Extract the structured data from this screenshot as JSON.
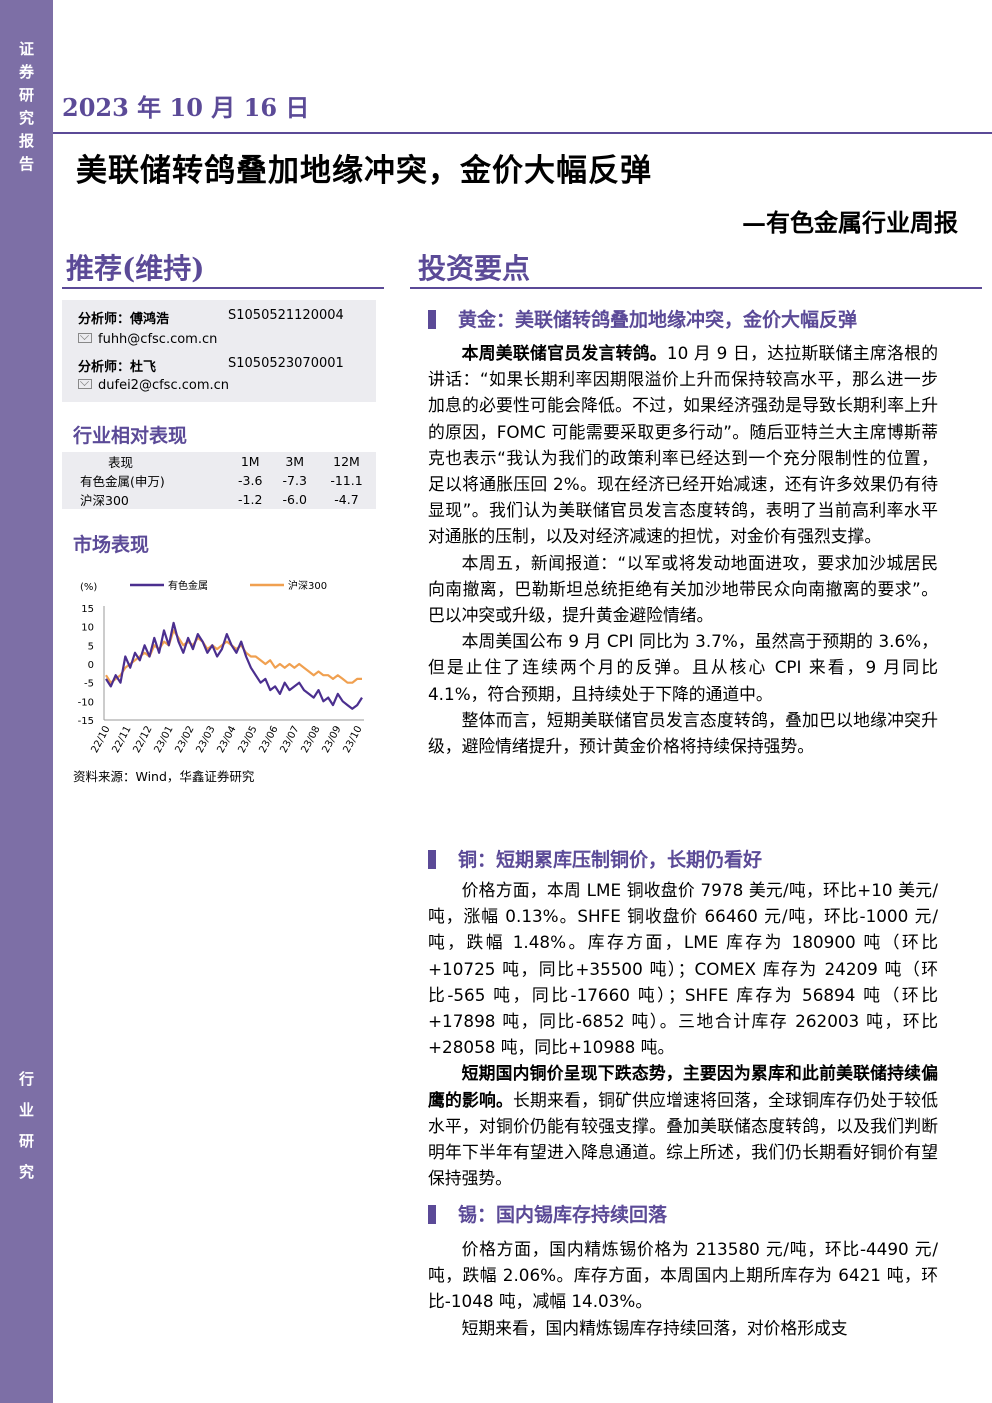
{
  "sidebar": {
    "top_chars": [
      "证",
      "券",
      "研",
      "究",
      "报",
      "告"
    ],
    "bottom_chars": [
      "行",
      "业",
      "研",
      "究"
    ]
  },
  "header": {
    "date": "2023 年 10 月 16 日",
    "title": "美联储转鸽叠加地缘冲突，金价大幅反弹",
    "subtitle": "—有色金属行业周报"
  },
  "left": {
    "rating": "推荐(维持)",
    "analysts": [
      {
        "label": "分析师：",
        "name": "傅鸿浩",
        "code": "S1050521120004",
        "email": "fuhh@cfsc.com.cn"
      },
      {
        "label": "分析师：",
        "name": "杜飞",
        "code": "S1050523070001",
        "email": "dufei2@cfsc.com.cn"
      }
    ],
    "perf_heading": "行业相对表现",
    "perf_table": {
      "headers": [
        "表现",
        "1M",
        "3M",
        "12M"
      ],
      "rows": [
        [
          "有色金属(申万)",
          "-3.6",
          "-7.3",
          "-11.1"
        ],
        [
          "沪深300",
          "-1.2",
          "-6.0",
          "-4.7"
        ]
      ]
    },
    "market_heading": "市场表现",
    "source": "资料来源：Wind，华鑫证券研究"
  },
  "chart_data": {
    "type": "line",
    "ylabel": "(%)",
    "ylim": [
      -15,
      15
    ],
    "yticks": [
      15,
      10,
      5,
      0,
      -5,
      -10,
      -15
    ],
    "xticks": [
      "22/10",
      "22/11",
      "22/12",
      "23/01",
      "23/02",
      "23/03",
      "23/04",
      "23/05",
      "23/06",
      "23/07",
      "23/08",
      "23/09",
      "23/10"
    ],
    "series": [
      {
        "name": "有色金属",
        "color": "#4b2f8f",
        "values": [
          -4,
          -6,
          -3,
          -5,
          2,
          -1,
          3,
          1,
          5,
          2,
          7,
          3,
          9,
          5,
          11,
          6,
          3,
          7,
          4,
          8,
          6,
          3,
          5,
          2,
          4,
          8,
          5,
          3,
          6,
          2,
          -1,
          -3,
          -5,
          -4,
          -7,
          -6,
          -8,
          -5,
          -7,
          -6,
          -5,
          -7,
          -8,
          -9,
          -7,
          -10,
          -9,
          -11,
          -8,
          -10,
          -11,
          -12,
          -11,
          -9
        ]
      },
      {
        "name": "沪深300",
        "color": "#f0a050",
        "values": [
          -3,
          -5,
          -4,
          -3,
          -1,
          0,
          1,
          2,
          3,
          2,
          5,
          4,
          6,
          5,
          9,
          7,
          5,
          6,
          5,
          7,
          6,
          4,
          5,
          4,
          5,
          6,
          5,
          4,
          5,
          3,
          2,
          2,
          1,
          0,
          1,
          -1,
          0,
          -1,
          0,
          -1,
          0,
          -1,
          -2,
          -3,
          -2,
          -3,
          -3,
          -4,
          -3,
          -4,
          -5,
          -5,
          -4,
          -4
        ]
      }
    ]
  },
  "right": {
    "heading": "投资要点",
    "sections": [
      {
        "title": "黄金：美联储转鸽叠加地缘冲突，金价大幅反弹",
        "paragraphs": [
          {
            "bold": "本周美联储官员发言转鸽。",
            "text": "10 月 9 日，达拉斯联储主席洛根的讲话：“如果长期利率因期限溢价上升而保持较高水平，那么进一步加息的必要性可能会降低。不过，如果经济强劲是导致长期利率上升的原因，FOMC 可能需要采取更多行动”。随后亚特兰大主席博斯蒂克也表示“我认为我们的政策利率已经达到一个充分限制性的位置，足以将通胀压回 2%。现在经济已经开始减速，还有许多效果仍有待显现”。我们认为美联储官员发言态度转鸽，表明了当前高利率水平对通胀的压制，以及对经济减速的担忧，对金价有强烈支撑。"
          },
          {
            "bold": "",
            "text": "本周五，新闻报道：“以军或将发动地面进攻，要求加沙城居民向南撤离，巴勒斯坦总统拒绝有关加沙地带民众向南撤离的要求”。巴以冲突或升级，提升黄金避险情绪。"
          },
          {
            "bold": "",
            "text": "本周美国公布 9 月 CPI 同比为 3.7%，虽然高于预期的 3.6%，但是止住了连续两个月的反弹。且从核心 CPI 来看，9 月同比 4.1%，符合预期，且持续处于下降的通道中。"
          },
          {
            "bold": "",
            "text": "整体而言，短期美联储官员发言态度转鸽，叠加巴以地缘冲突升级，避险情绪提升，预计黄金价格将持续保持强势。"
          }
        ]
      },
      {
        "title": "铜：短期累库压制铜价，长期仍看好",
        "paragraphs": [
          {
            "bold": "",
            "text": "价格方面，本周 LME 铜收盘价 7978 美元/吨，环比+10 美元/吨，涨幅 0.13%。SHFE 铜收盘价 66460 元/吨，环比-1000 元/吨，跌幅 1.48%。库存方面，LME 库存为 180900 吨（环比+10725 吨，同比+35500 吨）；COMEX 库存为 24209 吨（环比-565 吨，同比-17660 吨）；SHFE 库存为 56894 吨（环比+17898 吨，同比-6852 吨）。三地合计库存 262003 吨，环比+28058 吨，同比+10988 吨。"
          },
          {
            "bold": "短期国内铜价呈现下跌态势，主要因为累库和此前美联储持续偏鹰的影响。",
            "text": "长期来看，铜矿供应增速将回落，全球铜库存仍处于较低水平，对铜价仍能有较强支撑。叠加美联储态度转鸽，以及我们判断明年下半年有望进入降息通道。综上所述，我们仍长期看好铜价有望保持强势。"
          }
        ]
      },
      {
        "title": "锡：国内锡库存持续回落",
        "paragraphs": [
          {
            "bold": "",
            "text": "价格方面，国内精炼锡价格为 213580 元/吨，环比-4490 元/吨，跌幅 2.06%。库存方面，本周国内上期所库存为 6421 吨，环比-1048 吨，减幅 14.03%。"
          },
          {
            "bold": "",
            "text": "短期来看，国内精炼锡库存持续回落，对价格形成支"
          }
        ]
      }
    ]
  }
}
